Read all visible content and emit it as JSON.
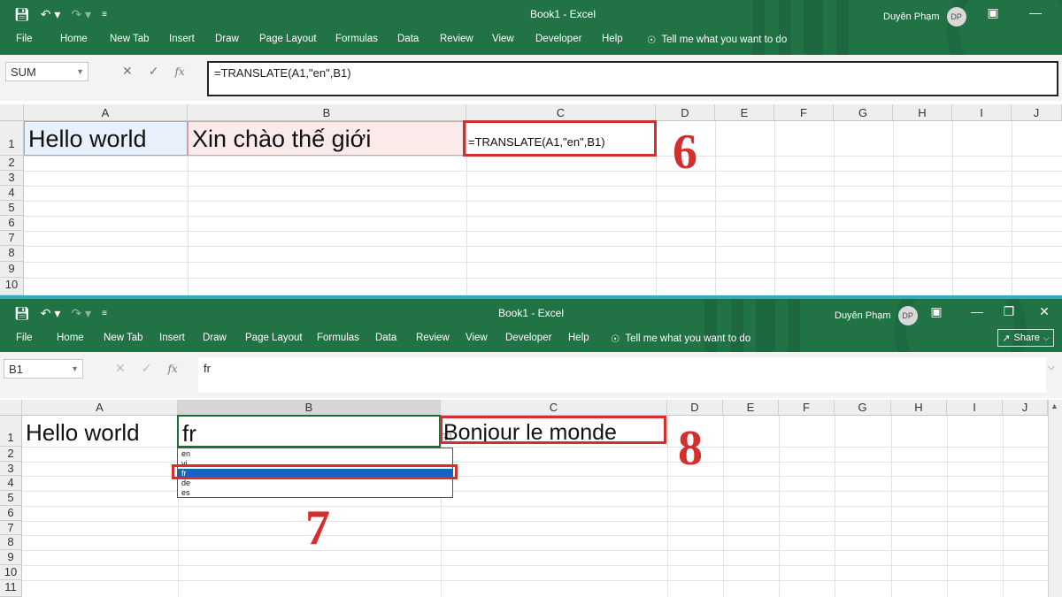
{
  "colors": {
    "ribbon": "#217346",
    "annotation": "#d32f2f",
    "selection": "#1565c0"
  },
  "top": {
    "title": "Book1  -  Excel",
    "user_name": "Duyên Phạm",
    "user_initials": "DP",
    "menu": [
      "File",
      "Home",
      "New Tab",
      "Insert",
      "Draw",
      "Page Layout",
      "Formulas",
      "Data",
      "Review",
      "View",
      "Developer",
      "Help"
    ],
    "tell_me": "Tell me what you want to do",
    "name_box": "SUM",
    "formula": "=TRANSLATE(A1,\"en\",B1)",
    "columns": [
      "A",
      "B",
      "C",
      "D",
      "E",
      "F",
      "G",
      "H",
      "I",
      "J"
    ],
    "rows": [
      "1",
      "2",
      "3",
      "4",
      "5",
      "6",
      "7",
      "8",
      "9",
      "10"
    ],
    "cells": {
      "A1": "Hello world",
      "B1": "Xin chào thế giới",
      "C1": "=TRANSLATE(A1,\"en\",B1)"
    },
    "step_label": "6"
  },
  "bottom": {
    "title": "Book1  -  Excel",
    "user_name": "Duyên Phạm",
    "user_initials": "DP",
    "menu": [
      "File",
      "Home",
      "New Tab",
      "Insert",
      "Draw",
      "Page Layout",
      "Formulas",
      "Data",
      "Review",
      "View",
      "Developer",
      "Help"
    ],
    "tell_me": "Tell me what you want to do",
    "share_label": "Share",
    "name_box": "B1",
    "formula": "fr",
    "columns": [
      "A",
      "B",
      "C",
      "D",
      "E",
      "F",
      "G",
      "H",
      "I",
      "J"
    ],
    "rows": [
      "1",
      "2",
      "3",
      "4",
      "5",
      "6",
      "7",
      "8",
      "9",
      "10",
      "11"
    ],
    "cells": {
      "A1": "Hello world",
      "B1": "fr",
      "C1": "Bonjour le monde"
    },
    "dropdown_options": [
      "en",
      "vi",
      "fr",
      "de",
      "es"
    ],
    "dropdown_selected": "fr",
    "step_label_dropdown": "7",
    "step_label_result": "8"
  }
}
